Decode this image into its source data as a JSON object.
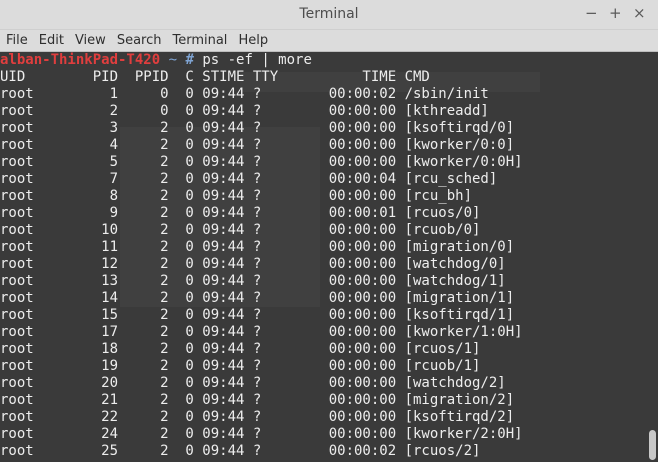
{
  "window": {
    "title": "Terminal",
    "minimize": "−",
    "maximize": "+",
    "close": "×"
  },
  "menu": [
    "File",
    "Edit",
    "View",
    "Search",
    "Terminal",
    "Help"
  ],
  "prompt": {
    "host": "alban-ThinkPad-T420",
    "path": " ~ ",
    "hash": "#",
    "command": " ps -ef | more"
  },
  "header": "UID        PID  PPID  C STIME TTY          TIME CMD",
  "rows": [
    "root         1     0  0 09:44 ?        00:00:02 /sbin/init",
    "root         2     0  0 09:44 ?        00:00:00 [kthreadd]",
    "root         3     2  0 09:44 ?        00:00:00 [ksoftirqd/0]",
    "root         4     2  0 09:44 ?        00:00:00 [kworker/0:0]",
    "root         5     2  0 09:44 ?        00:00:00 [kworker/0:0H]",
    "root         7     2  0 09:44 ?        00:00:04 [rcu_sched]",
    "root         8     2  0 09:44 ?        00:00:00 [rcu_bh]",
    "root         9     2  0 09:44 ?        00:00:01 [rcuos/0]",
    "root        10     2  0 09:44 ?        00:00:00 [rcuob/0]",
    "root        11     2  0 09:44 ?        00:00:00 [migration/0]",
    "root        12     2  0 09:44 ?        00:00:00 [watchdog/0]",
    "root        13     2  0 09:44 ?        00:00:00 [watchdog/1]",
    "root        14     2  0 09:44 ?        00:00:00 [migration/1]",
    "root        15     2  0 09:44 ?        00:00:00 [ksoftirqd/1]",
    "root        17     2  0 09:44 ?        00:00:00 [kworker/1:0H]",
    "root        18     2  0 09:44 ?        00:00:00 [rcuos/1]",
    "root        19     2  0 09:44 ?        00:00:00 [rcuob/1]",
    "root        20     2  0 09:44 ?        00:00:00 [watchdog/2]",
    "root        21     2  0 09:44 ?        00:00:00 [migration/2]",
    "root        22     2  0 09:44 ?        00:00:00 [ksoftirqd/2]",
    "root        24     2  0 09:44 ?        00:00:00 [kworker/2:0H]",
    "root        25     2  0 09:44 ?        00:00:02 [rcuos/2]"
  ],
  "colors": {
    "prompt_host": "#e03e3e",
    "prompt_path": "#7fa4d3",
    "terminal_bg": "#3a3a3a",
    "text": "#ededed"
  }
}
